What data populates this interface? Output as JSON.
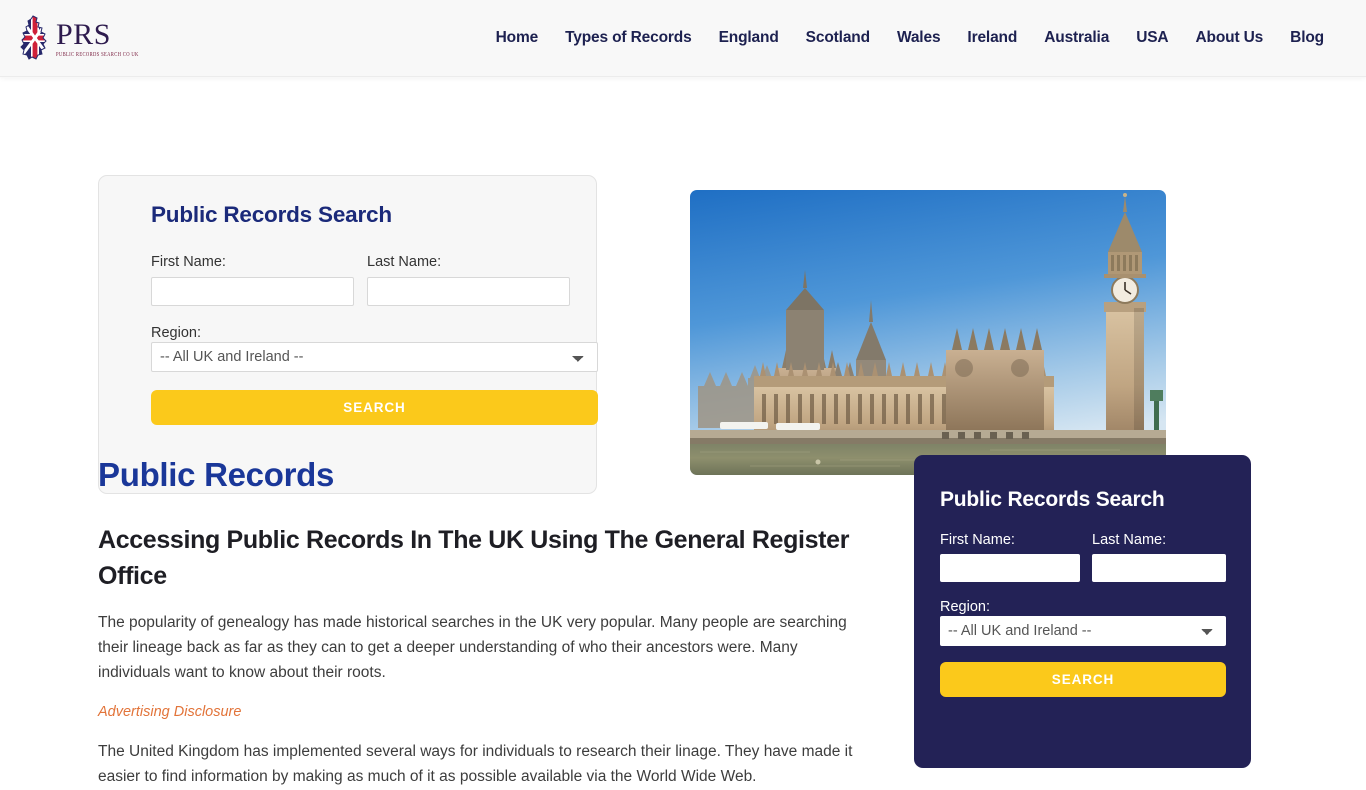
{
  "header": {
    "logo": {
      "name": "PRS",
      "tagline": "PUBLIC RECORDS SEARCH CO UK",
      "icon": "uk-map-union-jack-icon"
    },
    "nav_items": [
      {
        "label": "Home"
      },
      {
        "label": "Types of Records"
      },
      {
        "label": "England"
      },
      {
        "label": "Scotland"
      },
      {
        "label": "Wales"
      },
      {
        "label": "Ireland"
      },
      {
        "label": "Australia"
      },
      {
        "label": "USA"
      },
      {
        "label": "About Us"
      },
      {
        "label": "Blog"
      }
    ]
  },
  "hero": {
    "search_form": {
      "title": "Public Records Search",
      "first_name_label": "First Name:",
      "first_name_value": "",
      "last_name_label": "Last Name:",
      "last_name_value": "",
      "region_label": "Region:",
      "region_selected": "-- All UK and Ireland --",
      "submit_label": "SEARCH"
    },
    "image": {
      "alt": "Houses of Parliament and Big Ben, London",
      "icon": "parliament-photo"
    }
  },
  "main": {
    "page_title": "Public Records",
    "section_heading": "Accessing Public Records In The UK Using The General Register Office",
    "paragraph_1": "The popularity of genealogy has made historical searches in the UK very popular. Many people are searching their lineage back as far as they can to get a deeper understanding of who their ancestors were. Many individuals want to know about their roots.",
    "disclosure_link": "Advertising Disclosure",
    "paragraph_2": "The United Kingdom has implemented several ways for individuals to research their linage. They have made it easier to find information by making as much of it as possible available via the World Wide Web."
  },
  "sidebar": {
    "search_form": {
      "title": "Public Records Search",
      "first_name_label": "First Name:",
      "first_name_value": "",
      "last_name_label": "Last Name:",
      "last_name_value": "",
      "region_label": "Region:",
      "region_selected": "-- All UK and Ireland --",
      "submit_label": "SEARCH"
    }
  },
  "colors": {
    "accent_yellow": "#fbc91b",
    "brand_navy": "#232256",
    "title_blue": "#1a3799",
    "nav_navy": "#1d2150",
    "disclosure_orange": "#e2743a",
    "header_bg": "#f8f8f8",
    "card_bg": "#f7f7f7"
  }
}
